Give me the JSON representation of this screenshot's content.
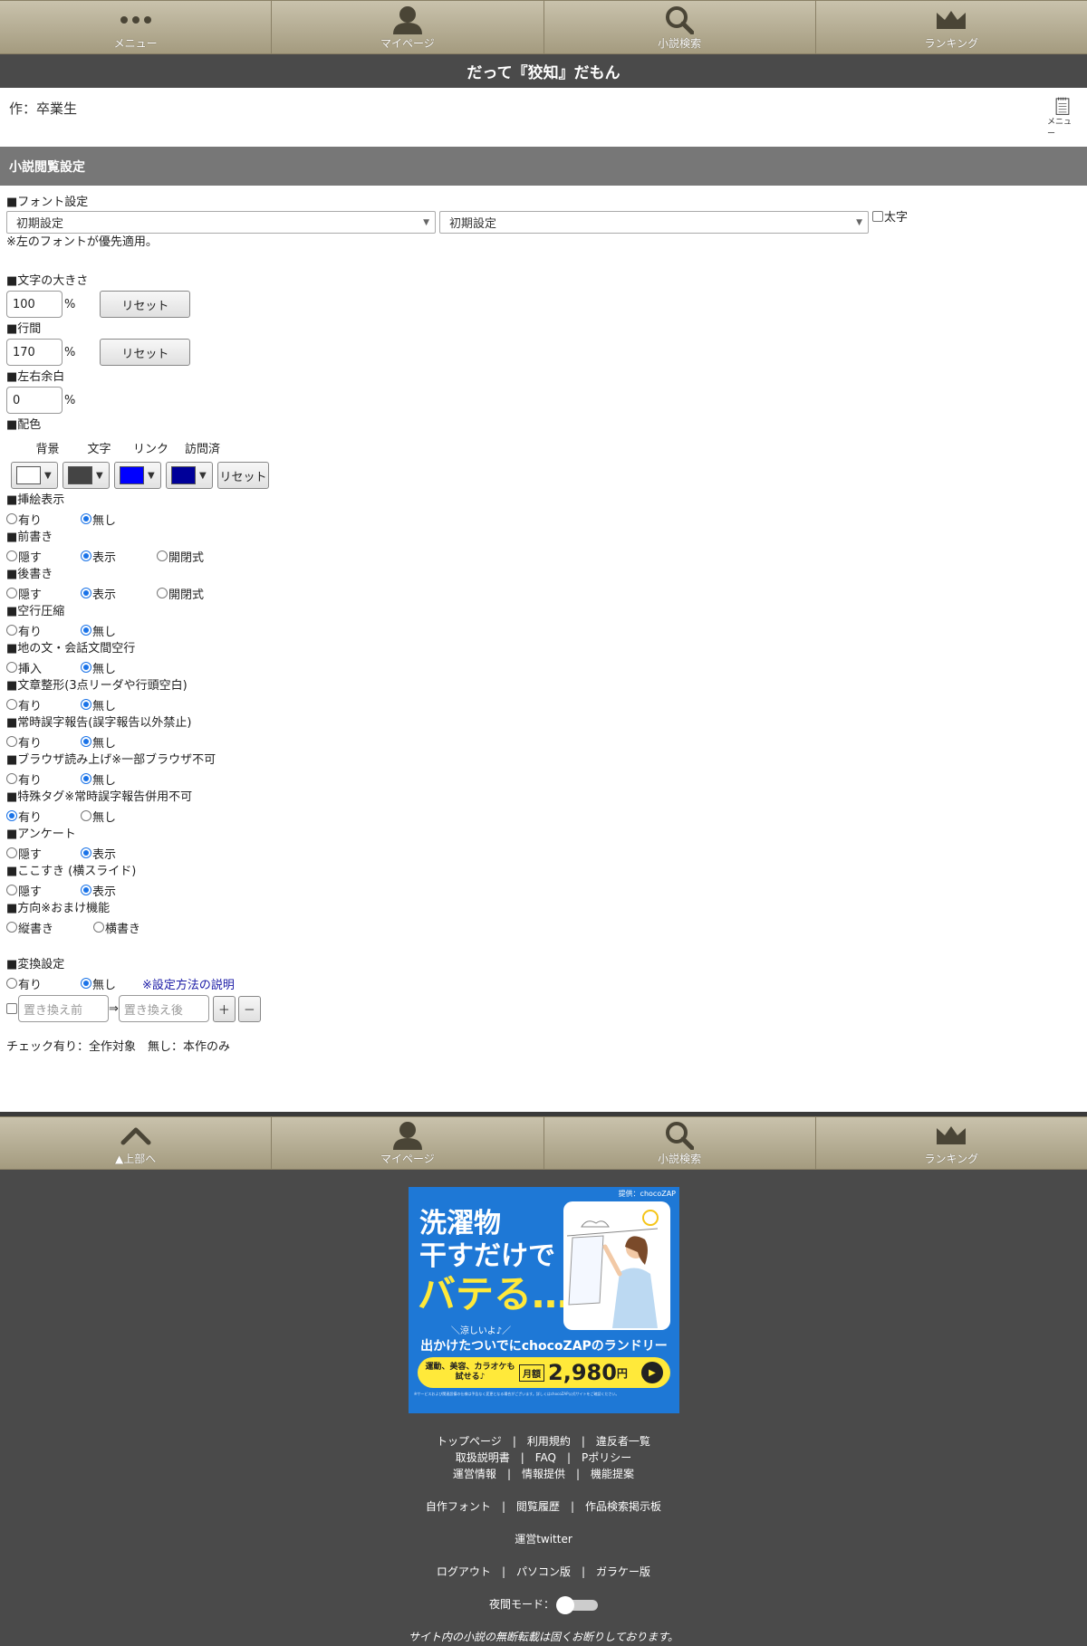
{
  "nav": {
    "items": [
      {
        "label": "メニュー",
        "icon": "dots-icon"
      },
      {
        "label": "マイページ",
        "icon": "user-icon"
      },
      {
        "label": "小説検索",
        "icon": "search-icon"
      },
      {
        "label": "ランキング",
        "icon": "crown-icon"
      }
    ]
  },
  "novel": {
    "title": "だって『狡知』だもん",
    "author": "作：卒業生",
    "memo_label": "メニュー"
  },
  "settings": {
    "header": "小説閲覧設定",
    "font": {
      "label": "■フォント設定",
      "select1": "初期設定",
      "select2": "初期設定",
      "bold_label": "太字",
      "note": "※左のフォントが優先適用。"
    },
    "size": {
      "label": "■文字の大きさ",
      "value": "100",
      "unit": "%",
      "reset": "リセット"
    },
    "line_height": {
      "label": "■行間",
      "value": "170",
      "unit": "%",
      "reset": "リセット"
    },
    "margin": {
      "label": "■左右余白",
      "value": "0",
      "unit": "%"
    },
    "colors": {
      "label": "■配色",
      "heads": [
        "背景",
        "文字",
        "リンク",
        "訪問済"
      ],
      "values": [
        "#ffffff",
        "#444444",
        "#0000ff",
        "#000099"
      ],
      "reset": "リセット"
    },
    "radios": [
      {
        "label": "■挿絵表示",
        "options": [
          "有り",
          "無し"
        ],
        "selected": 1
      },
      {
        "label": "■前書き",
        "options": [
          "隠す",
          "表示",
          "開閉式"
        ],
        "selected": 1
      },
      {
        "label": "■後書き",
        "options": [
          "隠す",
          "表示",
          "開閉式"
        ],
        "selected": 1
      },
      {
        "label": "■空行圧縮",
        "options": [
          "有り",
          "無し"
        ],
        "selected": 1
      },
      {
        "label": "■地の文・会話文間空行",
        "options": [
          "挿入",
          "無し"
        ],
        "selected": 1
      },
      {
        "label": "■文章整形(3点リーダや行頭空白)",
        "options": [
          "有り",
          "無し"
        ],
        "selected": 1
      },
      {
        "label": "■常時誤字報告(誤字報告以外禁止)",
        "options": [
          "有り",
          "無し"
        ],
        "selected": 1
      },
      {
        "label": "■ブラウザ読み上げ※一部ブラウザ不可",
        "options": [
          "有り",
          "無し"
        ],
        "selected": 1
      },
      {
        "label": "■特殊タグ※常時誤字報告併用不可",
        "options": [
          "有り",
          "無し"
        ],
        "selected": 0
      },
      {
        "label": "■アンケート",
        "options": [
          "隠す",
          "表示"
        ],
        "selected": 1
      },
      {
        "label": "■ここすき (横スライド)",
        "options": [
          "隠す",
          "表示"
        ],
        "selected": 1
      },
      {
        "label": "■方向※おまけ機能",
        "options": [
          "縦書き",
          "横書き"
        ],
        "selected": -1
      }
    ],
    "replace": {
      "label": "■変換設定",
      "options": [
        "有り",
        "無し"
      ],
      "selected": 1,
      "help_link": "※設定方法の説明",
      "before_placeholder": "置き換え前",
      "arrow": "⇒",
      "after_placeholder": "置き換え後",
      "plus": "＋",
      "minus": "－",
      "note": "チェック有り：全作対象　無し：本作のみ"
    }
  },
  "footer_nav": {
    "items": [
      {
        "label": "▲上部へ",
        "icon": "chevron-up-icon"
      },
      {
        "label": "マイページ",
        "icon": "user-icon"
      },
      {
        "label": "小説検索",
        "icon": "search-icon"
      },
      {
        "label": "ランキング",
        "icon": "crown-icon"
      }
    ]
  },
  "ad": {
    "provider": "提供：chocoZAP",
    "line1": "洗濯物",
    "line2": "干すだけで",
    "line3": "バテる…",
    "sub1": "＼涼しいよ♪／",
    "sub2": "出かけたついでにchocoZAPのランドリー",
    "cta_small": "運動、美容、カラオケも試せる♪",
    "cta_plan": "月額",
    "cta_price": "2,980",
    "cta_yen": "円",
    "fineprint": "※サービスおよび関連設備の仕様は予告なく変更となる場合がございます。詳しくはchocoZAP公式サイトをご確認ください。"
  },
  "footer": {
    "row1": [
      "トップページ",
      "利用規約",
      "違反者一覧"
    ],
    "row2": [
      "取扱説明書",
      "FAQ",
      "Pポリシー"
    ],
    "row3": [
      "運営情報",
      "情報提供",
      "機能提案"
    ],
    "row4": [
      "自作フォント",
      "閲覧履歴",
      "作品検索掲示板"
    ],
    "row5": [
      "運営twitter"
    ],
    "row6": [
      "ログアウト",
      "パソコン版",
      "ガラケー版"
    ],
    "night_mode": "夜間モード：",
    "copyright": "サイト内の小説の無断転載は固くお断りしております。"
  }
}
